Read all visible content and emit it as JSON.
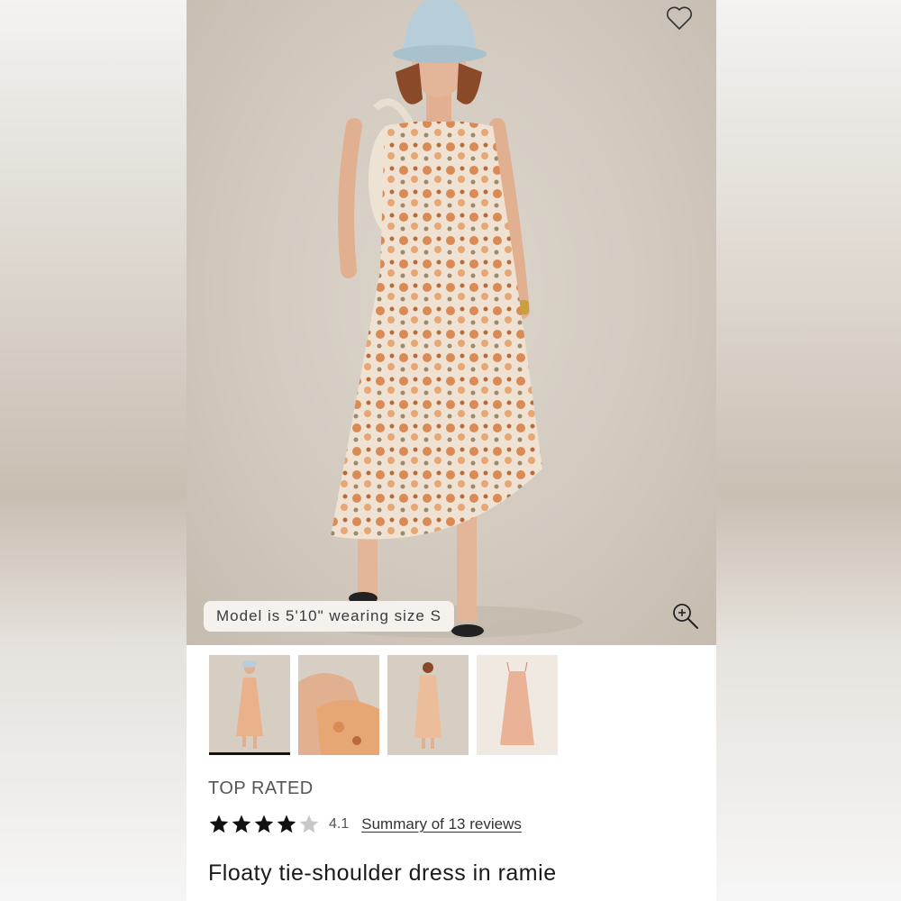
{
  "hero": {
    "model_info": "Model is 5'10\" wearing size S",
    "favorite_icon": "heart-outline-icon",
    "zoom_icon": "zoom-in-icon"
  },
  "thumbnails": [
    {
      "label": "full-front",
      "active": true
    },
    {
      "label": "shoulder-detail",
      "active": false
    },
    {
      "label": "back-view",
      "active": false
    },
    {
      "label": "flat-lay",
      "active": false
    }
  ],
  "product": {
    "badge": "TOP RATED",
    "rating": {
      "value": 4.1,
      "max": 5,
      "display": "4.1"
    },
    "reviews_link": "Summary of 13 reviews",
    "title": "Floaty tie-shoulder dress in ramie"
  },
  "colors": {
    "star_filled": "#111111",
    "star_empty": "#c8c8c8"
  }
}
